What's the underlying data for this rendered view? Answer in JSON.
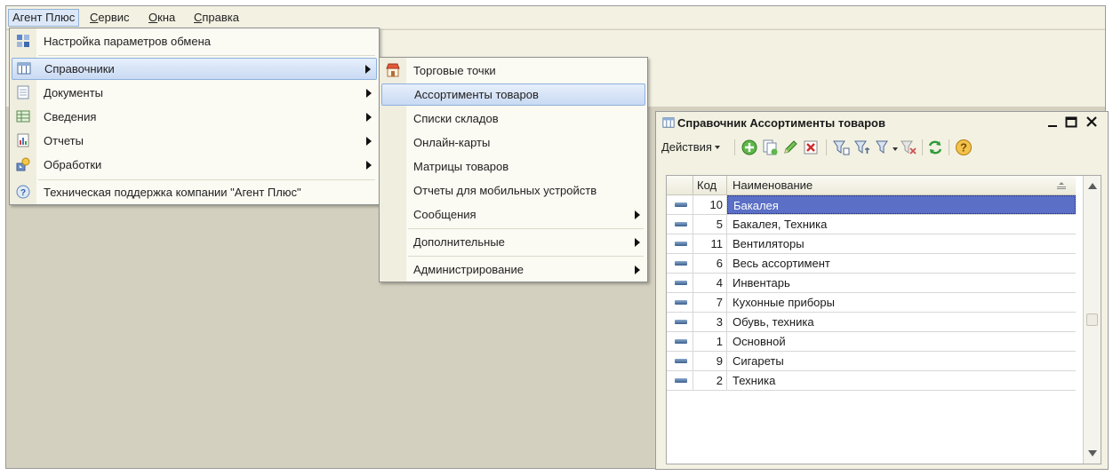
{
  "menubar": {
    "items": [
      {
        "label": "Агент Плюс"
      },
      {
        "label": "Сервис",
        "mnemonic": "С",
        "rest": "ервис"
      },
      {
        "label": "Окна",
        "mnemonic": "О",
        "rest": "кна"
      },
      {
        "label": "Справка",
        "mnemonic": "С",
        "rest": "правка"
      }
    ]
  },
  "main_menu": {
    "items": [
      {
        "label": "Настройка параметров обмена",
        "icon": "exchange-settings-icon"
      },
      {
        "label": "Справочники",
        "icon": "catalog-icon",
        "submenu": true
      },
      {
        "label": "Документы",
        "icon": "document-icon",
        "submenu": true
      },
      {
        "label": "Сведения",
        "icon": "info-table-icon",
        "submenu": true
      },
      {
        "label": "Отчеты",
        "icon": "report-chart-icon",
        "submenu": true
      },
      {
        "label": "Обработки",
        "icon": "processing-icon",
        "submenu": true
      },
      {
        "label": "Техническая поддержка компании \"Агент Плюс\"",
        "icon": "help-icon"
      }
    ]
  },
  "submenu": {
    "items": [
      {
        "label": "Торговые точки",
        "icon": "store-icon"
      },
      {
        "label": "Ассортименты товаров"
      },
      {
        "label": "Списки складов"
      },
      {
        "label": "Онлайн-карты"
      },
      {
        "label": "Матрицы товаров"
      },
      {
        "label": "Отчеты для мобильных устройств"
      },
      {
        "label": "Сообщения",
        "submenu": true
      },
      {
        "label": "Дополнительные",
        "submenu": true
      },
      {
        "label": "Администрирование",
        "submenu": true
      }
    ]
  },
  "window": {
    "title": "Справочник Ассортименты товаров",
    "toolbar": {
      "actions_label": "Действия"
    },
    "table": {
      "columns": [
        "Код",
        "Наименование"
      ],
      "rows": [
        {
          "code": "10",
          "name": "Бакалея"
        },
        {
          "code": "5",
          "name": "Бакалея, Техника"
        },
        {
          "code": "11",
          "name": "Вентиляторы"
        },
        {
          "code": "6",
          "name": "Весь ассортимент"
        },
        {
          "code": "4",
          "name": "Инвентарь"
        },
        {
          "code": "7",
          "name": "Кухонные приборы"
        },
        {
          "code": "3",
          "name": "Обувь, техника"
        },
        {
          "code": "1",
          "name": "Основной"
        },
        {
          "code": "9",
          "name": "Сигареты"
        },
        {
          "code": "2",
          "name": "Техника"
        }
      ]
    }
  },
  "colors": {
    "menu_highlight": "#c9daf3",
    "selected_row": "#5a6fc5",
    "workspace": "#d4d0c0",
    "panel": "#f3f1e2"
  }
}
